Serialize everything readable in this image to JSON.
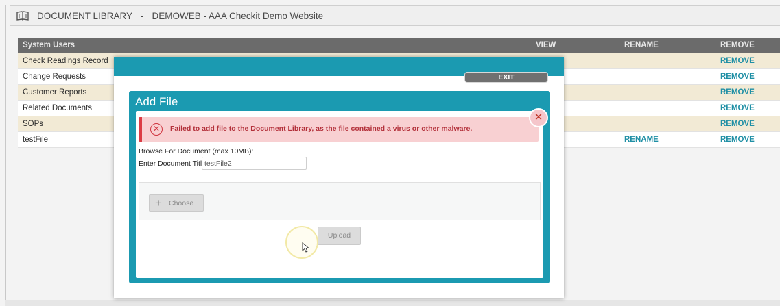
{
  "header": {
    "title": "DOCUMENT LIBRARY",
    "separator": "-",
    "subtitle": "DEMOWEB - AAA Checkit Demo Website",
    "icon": "book-icon"
  },
  "table": {
    "columns": {
      "name": "System Users",
      "view": "VIEW",
      "rename": "RENAME",
      "remove": "REMOVE"
    },
    "rows": [
      {
        "name": "Check Readings Record",
        "rename": "",
        "remove": "REMOVE"
      },
      {
        "name": "Change Requests",
        "rename": "",
        "remove": "REMOVE"
      },
      {
        "name": "Customer Reports",
        "rename": "",
        "remove": "REMOVE"
      },
      {
        "name": "Related Documents",
        "rename": "",
        "remove": "REMOVE"
      },
      {
        "name": "SOPs",
        "rename": "",
        "remove": "REMOVE"
      },
      {
        "name": "testFile",
        "rename": "RENAME",
        "remove": "REMOVE"
      }
    ]
  },
  "modal": {
    "exit_label": "EXIT",
    "dialog_title": "Add File",
    "close_icon": "close-icon",
    "alert": {
      "icon": "error-circle-x-icon",
      "message": "Failed to add file to the Document Library, as the file contained a virus or other malware."
    },
    "browse_label": "Browse For Document (max 10MB):",
    "title_label": "Enter Document Title:",
    "title_value": "testFile2",
    "choose_label": "Choose",
    "upload_label": "Upload"
  },
  "colors": {
    "accent": "#1b9ab1",
    "link": "#1f8fa5",
    "alert_bg": "#f8d0d2",
    "alert_border": "#dc3c45",
    "row_tint": "#f2ead5",
    "header_bar": "#6b6b6b"
  }
}
